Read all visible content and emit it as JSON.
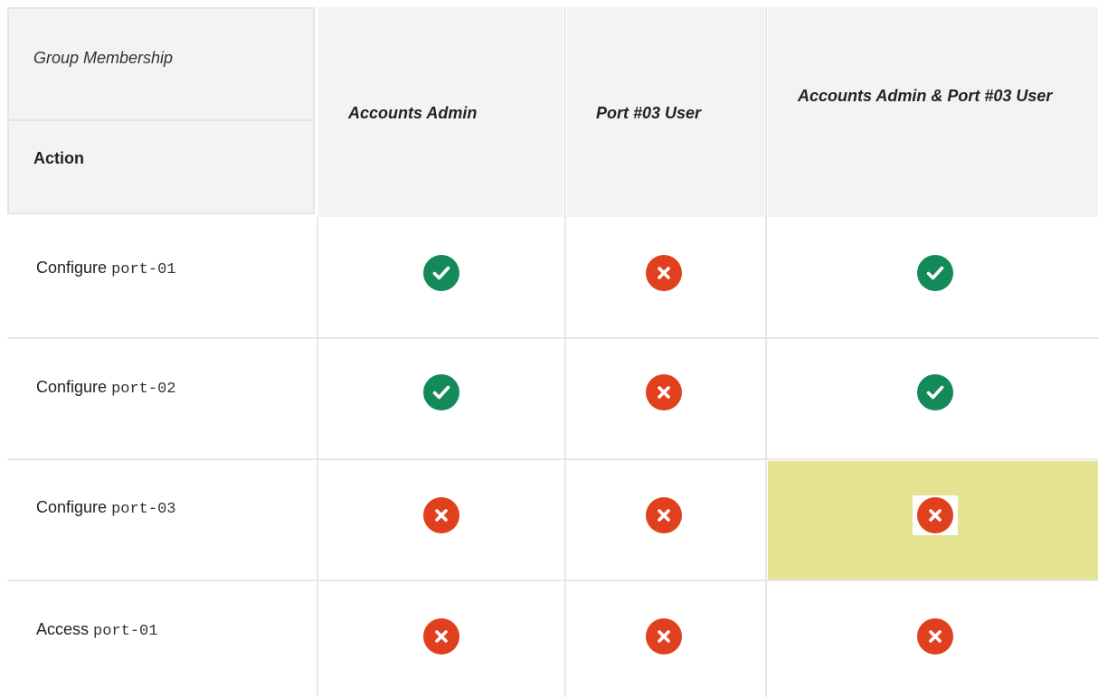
{
  "header": {
    "group_membership": "Group Membership",
    "action": "Action",
    "columns": [
      "Accounts Admin",
      "Port #03 User",
      "Accounts Admin & Port #03 User"
    ]
  },
  "rows": [
    {
      "label": "Configure",
      "code": "port-01",
      "results": [
        "allowed",
        "denied",
        "allowed"
      ]
    },
    {
      "label": "Configure",
      "code": "port-02",
      "results": [
        "allowed",
        "denied",
        "allowed"
      ]
    },
    {
      "label": "Configure",
      "code": "port-03",
      "results": [
        "denied",
        "denied",
        "denied"
      ],
      "highlighted_column": 3
    },
    {
      "label": "Access",
      "code": "port-01",
      "results": [
        "denied",
        "denied",
        "denied"
      ]
    }
  ],
  "colors": {
    "allowed": "#14895a",
    "denied": "#e0401e",
    "highlight": "#e4e492",
    "header_bg": "#f3f3f3"
  },
  "icons": {
    "allowed": "check-circle-icon",
    "denied": "x-circle-icon"
  }
}
